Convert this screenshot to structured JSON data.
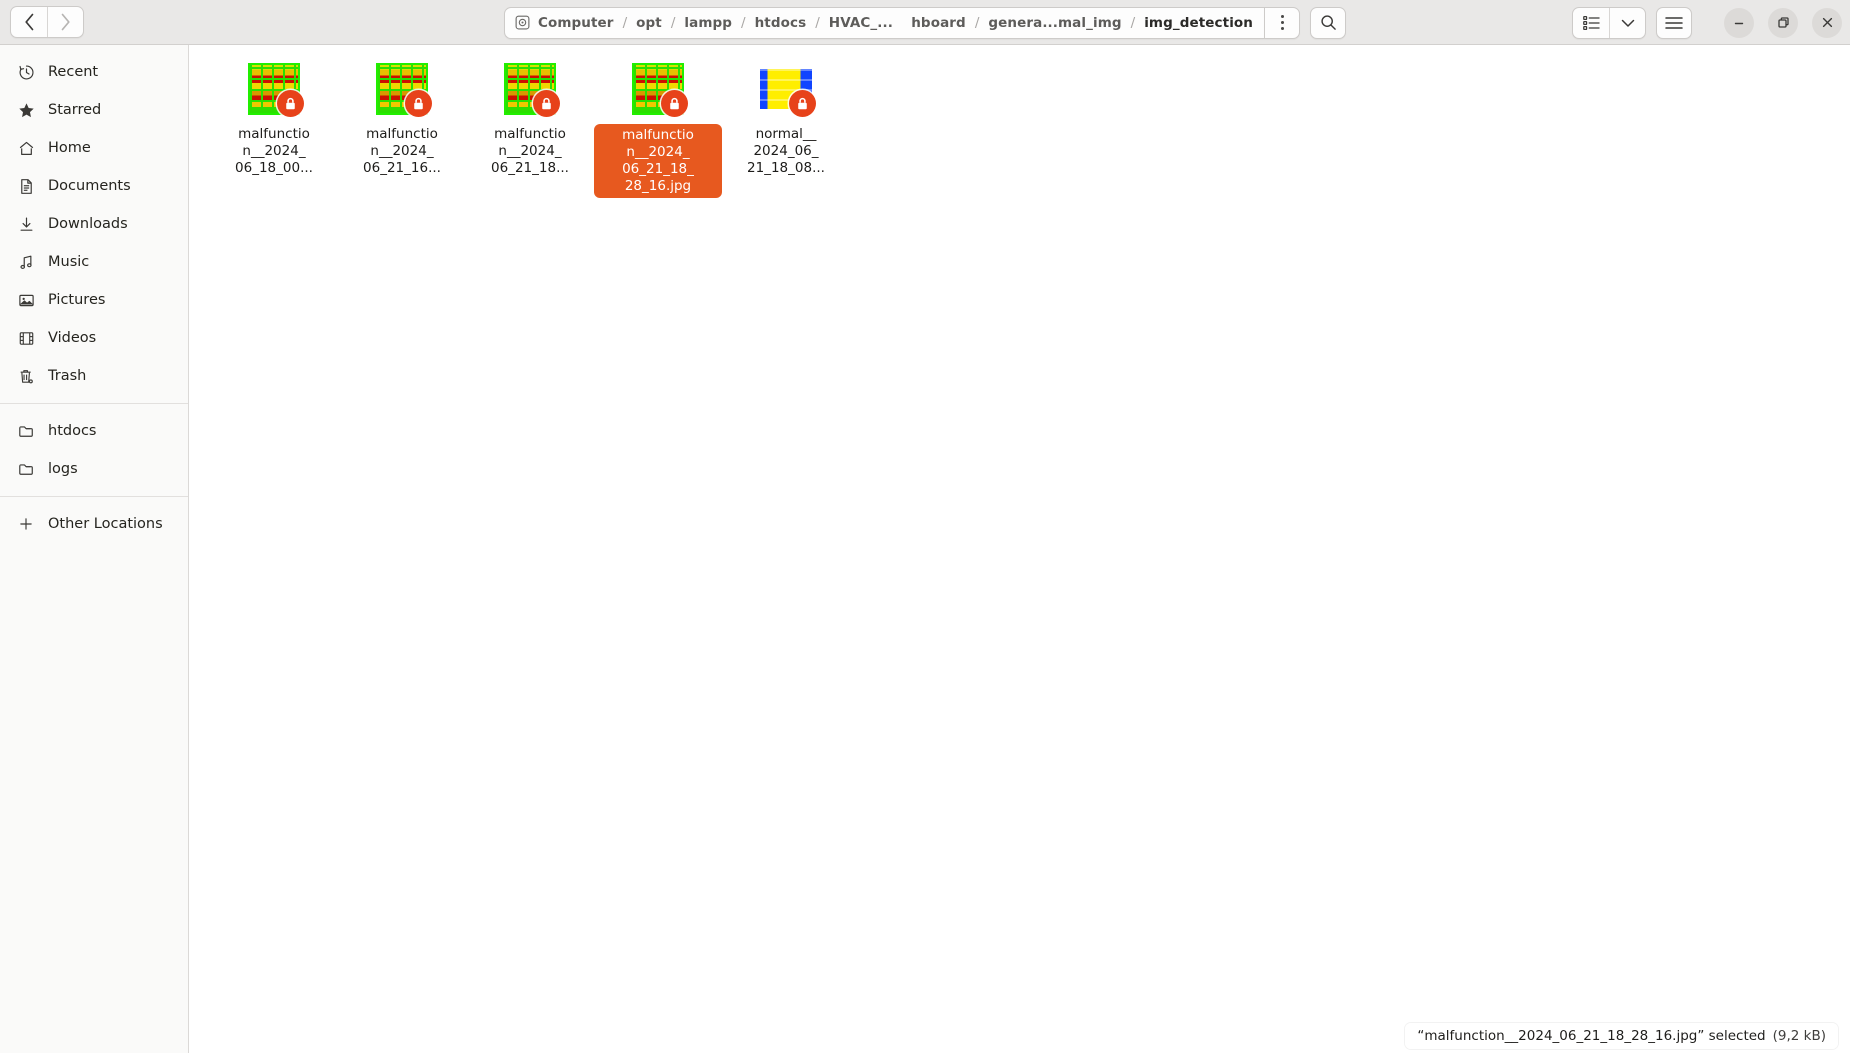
{
  "window": {
    "nav": {
      "back_label": "‹",
      "forward_label": "›"
    },
    "controls": {
      "minimize": "minimize",
      "maximize": "maximize",
      "close": "close"
    }
  },
  "breadcrumb": {
    "separator": "/",
    "items": [
      {
        "label": "Computer",
        "icon": "disk-icon",
        "current": false
      },
      {
        "label": "opt",
        "current": false
      },
      {
        "label": "lampp",
        "current": false
      },
      {
        "label": "htdocs",
        "current": false
      },
      {
        "label": "HVAC_...",
        "current": false
      },
      {
        "label": "hboard",
        "current": false
      },
      {
        "label": "genera...mal_img",
        "current": false
      },
      {
        "label": "img_detection",
        "current": true
      }
    ]
  },
  "toolbar": {
    "menu_button": "menu-button",
    "search_button": "search-button",
    "view_list_button": "view-list-button",
    "view_dropdown_button": "view-options-dropdown",
    "hamburger_button": "main-menu-button"
  },
  "sidebar": {
    "groups": [
      {
        "items": [
          {
            "label": "Recent",
            "icon": "clock-icon"
          },
          {
            "label": "Starred",
            "icon": "star-icon"
          },
          {
            "label": "Home",
            "icon": "home-icon"
          },
          {
            "label": "Documents",
            "icon": "document-icon"
          },
          {
            "label": "Downloads",
            "icon": "download-icon"
          },
          {
            "label": "Music",
            "icon": "music-note-icon"
          },
          {
            "label": "Pictures",
            "icon": "picture-icon"
          },
          {
            "label": "Videos",
            "icon": "film-icon"
          },
          {
            "label": "Trash",
            "icon": "trash-icon"
          }
        ]
      },
      {
        "items": [
          {
            "label": "htdocs",
            "icon": "folder-icon"
          },
          {
            "label": "logs",
            "icon": "folder-icon"
          }
        ]
      },
      {
        "items": [
          {
            "label": "Other Locations",
            "icon": "plus-icon"
          }
        ]
      }
    ]
  },
  "files": [
    {
      "name": "malfunction__2024_06_18_00...",
      "line1": "malfunctio",
      "line2": "n__2024_",
      "line3": "06_18_00...",
      "thumb": "thermal-malfunction-thumbnail",
      "badge": "lock-icon",
      "selected": false
    },
    {
      "name": "malfunction__2024_06_21_16...",
      "line1": "malfunctio",
      "line2": "n__2024_",
      "line3": "06_21_16...",
      "thumb": "thermal-malfunction-thumbnail",
      "badge": "lock-icon",
      "selected": false
    },
    {
      "name": "malfunction__2024_06_21_18...",
      "line1": "malfunctio",
      "line2": "n__2024_",
      "line3": "06_21_18...",
      "thumb": "thermal-malfunction-thumbnail",
      "badge": "lock-icon",
      "selected": false
    },
    {
      "name": "malfunction__2024_06_21_18_28_16.jpg",
      "line1": "malfunctio",
      "line2": "n__2024_",
      "line3": "06_21_18_",
      "line4": "28_16.jpg",
      "thumb": "thermal-malfunction-thumbnail",
      "badge": "lock-icon",
      "selected": true
    },
    {
      "name": "normal__2024_06_21_18_08...",
      "line1": "normal__",
      "line2": "2024_06_",
      "line3": "21_18_08...",
      "thumb": "thermal-normal-thumbnail",
      "badge": "lock-icon",
      "selected": false
    }
  ],
  "statusbar": {
    "selection": "“malfunction__2024_06_21_18_28_16.jpg” selected",
    "size": "(9,2 kB)"
  },
  "colors": {
    "header_bg": "#e9e8e7",
    "sidebar_bg": "#fafaf9",
    "selection": "#e7591f",
    "lock_badge": "#e7421a",
    "thumb_green": "#22ee00",
    "thumb_blue": "#1144ff",
    "thumb_yellow": "#ffee00"
  }
}
